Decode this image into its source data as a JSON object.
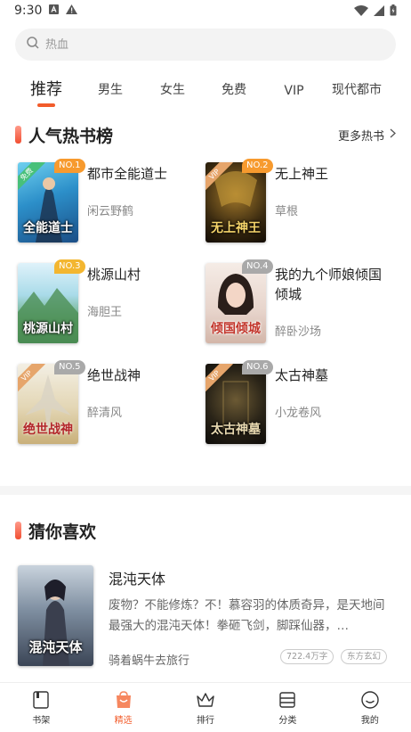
{
  "status_bar": {
    "time": "9:30"
  },
  "search": {
    "placeholder": "热血"
  },
  "tabs": [
    {
      "label": "推荐",
      "active": true
    },
    {
      "label": "男生"
    },
    {
      "label": "女生"
    },
    {
      "label": "免费"
    },
    {
      "label": "VIP"
    },
    {
      "label": "现代都市"
    }
  ],
  "hot_rank": {
    "title": "人气热书榜",
    "more": "更多热书",
    "books": [
      {
        "rank": "NO.1",
        "title": "都市全能道士",
        "author": "闲云野鹤",
        "cover_text": "全能道士",
        "corner": "免费"
      },
      {
        "rank": "NO.2",
        "title": "无上神王",
        "author": "草根",
        "cover_text": "无上神王",
        "corner": "VIP"
      },
      {
        "rank": "NO.3",
        "title": "桃源山村",
        "author": "海胆王",
        "cover_text": "桃源山村",
        "corner": ""
      },
      {
        "rank": "NO.4",
        "title": "我的九个师娘倾国倾城",
        "author": "醉卧沙场",
        "cover_text": "倾国倾城",
        "corner": ""
      },
      {
        "rank": "NO.5",
        "title": "绝世战神",
        "author": "醉清风",
        "cover_text": "绝世战神",
        "corner": "VIP"
      },
      {
        "rank": "NO.6",
        "title": "太古神墓",
        "author": "小龙卷风",
        "cover_text": "太古神墓",
        "corner": "VIP"
      }
    ]
  },
  "guess": {
    "title": "猜你喜欢",
    "book": {
      "title": "混沌天体",
      "description": "废物？不能修炼？不！慕容羽的体质奇异，是天地间最强大的混沌天体！拳砸飞剑，脚踩仙器，…",
      "author": "骑着蜗牛去旅行",
      "words": "722.4万字",
      "category": "东方玄幻",
      "cover_text": "混沌天体"
    }
  },
  "bottom_nav": [
    {
      "label": "书架",
      "icon": "bookshelf-icon"
    },
    {
      "label": "精选",
      "icon": "featured-bag-icon",
      "active": true
    },
    {
      "label": "排行",
      "icon": "crown-icon"
    },
    {
      "label": "分类",
      "icon": "category-icon"
    },
    {
      "label": "我的",
      "icon": "profile-icon"
    }
  ],
  "colors": {
    "accent": "#f25c2b",
    "badge_orange": "#f79a2e",
    "badge_gray": "#a9a9a9"
  }
}
